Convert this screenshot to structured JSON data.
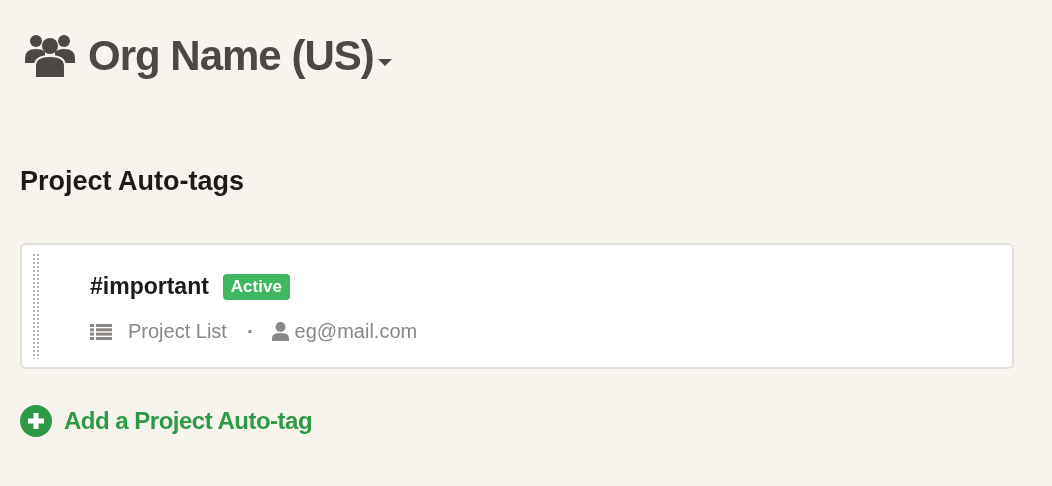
{
  "org": {
    "name": "Org Name (US)"
  },
  "section": {
    "title": "Project Auto-tags"
  },
  "auto_tags": [
    {
      "name": "#important",
      "status": {
        "label": "Active",
        "kind": "active"
      },
      "scope": "Project List",
      "separator": "·",
      "owner": "eg@mail.com"
    }
  ],
  "add_link": {
    "label": "Add a Project Auto-tag"
  }
}
